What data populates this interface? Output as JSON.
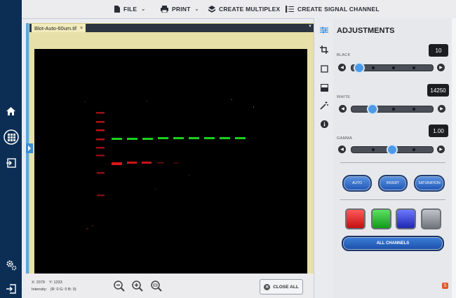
{
  "toolbar": {
    "file": {
      "label": "FILE",
      "icon": "file-icon"
    },
    "print": {
      "label": "PRINT",
      "icon": "printer-icon"
    },
    "multiplex": {
      "label": "CREATE MULTIPLEX",
      "icon": "layers-icon"
    },
    "signal": {
      "label": "CREATE SIGNAL CHANNEL",
      "icon": "channel-icon"
    }
  },
  "sidebar": {
    "items": [
      {
        "name": "home",
        "icon": "home-icon"
      },
      {
        "name": "apps",
        "icon": "grid-icon"
      },
      {
        "name": "import",
        "icon": "import-icon"
      },
      {
        "name": "settings",
        "icon": "gears-icon"
      },
      {
        "name": "logout",
        "icon": "logout-icon"
      }
    ]
  },
  "document": {
    "tab_title": "Blot-Auto-60um.tif",
    "tab_close": "×"
  },
  "status": {
    "x_label": "X:",
    "x_value": "2379",
    "y_label": "Y:",
    "y_value": "1233",
    "intensity_label": "Intensity:",
    "intensity_value": "(R: 0 G: 0 B: 0)",
    "close_all": "CLOSE ALL"
  },
  "tools": [
    "sliders-icon",
    "crop-icon",
    "select-rect-icon",
    "contrast-icon",
    "wand-icon",
    "info-icon"
  ],
  "adjustments": {
    "title": "ADJUSTMENTS",
    "black": {
      "label": "BLACK",
      "value": "10",
      "level": 0.03
    },
    "white": {
      "label": "WHITE",
      "value": "14250",
      "level": 0.22
    },
    "gamma": {
      "label": "GAMMA",
      "value": "1.00",
      "level": 0.5
    },
    "buttons": [
      "AUTO",
      "INVERT",
      "SATURATION"
    ],
    "channels": [
      {
        "name": "red",
        "color": "#e11d1d"
      },
      {
        "name": "green",
        "color": "#22b32c"
      },
      {
        "name": "blue",
        "color": "#2b39c8"
      },
      {
        "name": "gray",
        "color": "#8f939a"
      }
    ],
    "all_channels": "ALL CHANNELS"
  },
  "colors": {
    "nav": "#0c2e55",
    "accent": "#3a8fd6",
    "green_band": "#19d21c",
    "red_band": "#e0141c"
  }
}
